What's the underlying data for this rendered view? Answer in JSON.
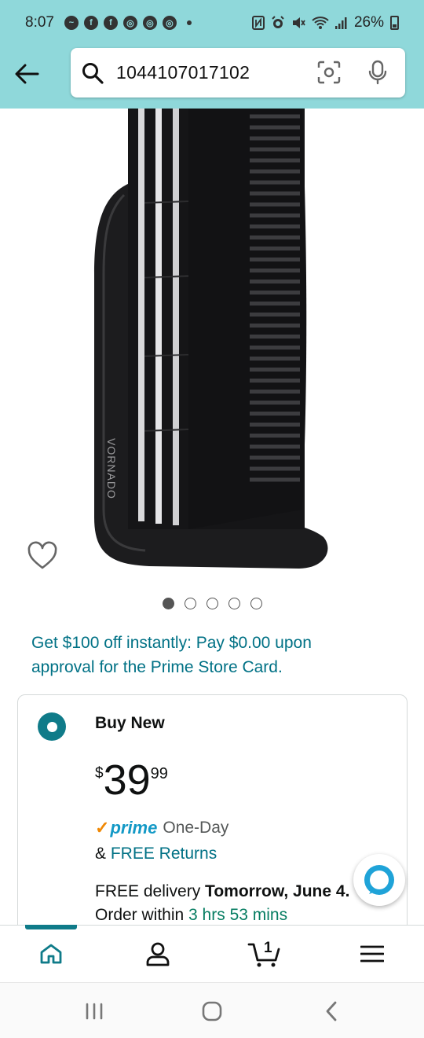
{
  "status_bar": {
    "time": "8:07",
    "battery": "26%",
    "notification_icons": [
      "messenger-icon",
      "facebook-icon",
      "facebook-icon",
      "chrome-icon",
      "chrome-icon",
      "chrome-icon"
    ]
  },
  "search": {
    "query": "1044107017102"
  },
  "product": {
    "brand_on_image": "VORNADO",
    "image_count": 5,
    "active_image_index": 0
  },
  "promo": {
    "text": "Get $100 off instantly: Pay $0.00 upon approval for the Prime Store Card."
  },
  "buy_box": {
    "option_label": "Buy New",
    "price_currency": "$",
    "price_whole": "39",
    "price_fraction": "99",
    "prime_label": "prime",
    "prime_speed": "One-Day",
    "returns_prefix": "& ",
    "returns_link": "FREE Returns",
    "delivery_prefix": "FREE delivery ",
    "delivery_date": "Tomorrow, June 4.",
    "order_prefix": "Order within ",
    "order_countdown": "3 hrs 53 mins"
  },
  "bottom_nav": {
    "cart_count": "1",
    "active_tab": "home"
  },
  "colors": {
    "header_bg": "#8fd8da",
    "link": "#007185",
    "accent": "#0f7b89",
    "prime_blue": "#1399c6",
    "prime_check": "#f08804",
    "green": "#067d62"
  }
}
